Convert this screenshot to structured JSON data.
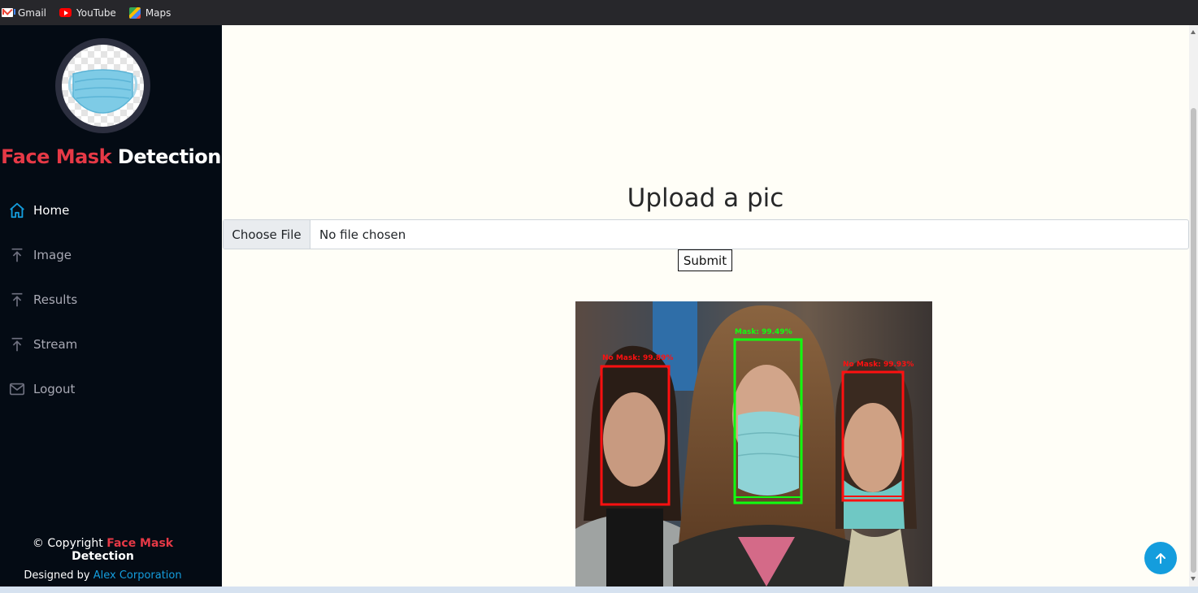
{
  "bookmarks": [
    {
      "label": "Gmail",
      "icon": "gmail-icon"
    },
    {
      "label": "YouTube",
      "icon": "youtube-icon"
    },
    {
      "label": "Maps",
      "icon": "maps-icon"
    }
  ],
  "sidebar": {
    "brand_red": "Face Mask",
    "brand_white": "Detection",
    "nav": [
      {
        "label": "Home",
        "icon": "home-icon",
        "active": true
      },
      {
        "label": "Image",
        "icon": "arrow-up-icon"
      },
      {
        "label": "Results",
        "icon": "arrow-up-icon"
      },
      {
        "label": "Stream",
        "icon": "arrow-up-icon"
      },
      {
        "label": "Logout",
        "icon": "envelope-icon"
      }
    ],
    "footer": {
      "copyright_prefix": "© Copyright",
      "copyright_red": "Face Mask",
      "copyright_white": "Detection",
      "designed_by": "Designed by",
      "designer": "Alex Corporation"
    }
  },
  "main": {
    "title": "Upload a pic",
    "choose_file_label": "Choose File",
    "no_file_text": "No file chosen",
    "submit_label": "Submit",
    "detections": [
      {
        "label": "No Mask: 99.89%",
        "color": "#ff0000"
      },
      {
        "label": "Mask: 99.49%",
        "color": "#00ff00"
      },
      {
        "label": "No Mask: 99.93%",
        "color": "#ff0000"
      }
    ]
  },
  "colors": {
    "accent": "#149ddd",
    "brand_red": "#e63946",
    "sidebar_bg": "#040b14",
    "page_bg": "#fffef7"
  }
}
